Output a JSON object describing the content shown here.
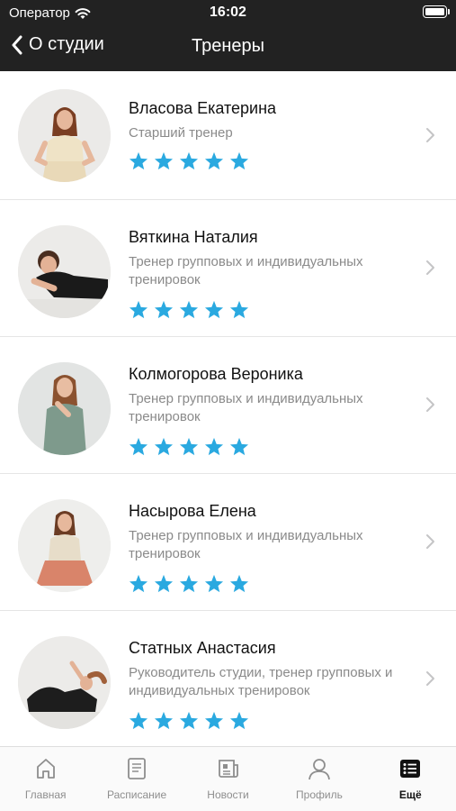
{
  "status_bar": {
    "carrier": "Оператор",
    "time": "16:02"
  },
  "nav": {
    "back_label": "О студии",
    "title": "Тренеры"
  },
  "colors": {
    "star": "#2aa9e0",
    "header_bg": "#222222"
  },
  "trainers": [
    {
      "name": "Власова Екатерина",
      "role": "Старший тренер",
      "rating": 5
    },
    {
      "name": "Вяткина Наталия",
      "role": "Тренер групповых и индивидуальных тренировок",
      "rating": 5
    },
    {
      "name": "Колмогорова Вероника",
      "role": "Тренер групповых и индивидуальных тренировок",
      "rating": 5
    },
    {
      "name": "Насырова Елена",
      "role": "Тренер групповых и индивидуальных тренировок",
      "rating": 5
    },
    {
      "name": "Статных Анастасия",
      "role": "Руководитель студии, тренер групповых и индивидуальных тренировок",
      "rating": 5
    }
  ],
  "tabbar": {
    "items": [
      {
        "label": "Главная",
        "icon": "home-icon"
      },
      {
        "label": "Расписание",
        "icon": "schedule-icon"
      },
      {
        "label": "Новости",
        "icon": "news-icon"
      },
      {
        "label": "Профиль",
        "icon": "profile-icon"
      },
      {
        "label": "Ещё",
        "icon": "more-list-icon",
        "active": true
      }
    ]
  }
}
